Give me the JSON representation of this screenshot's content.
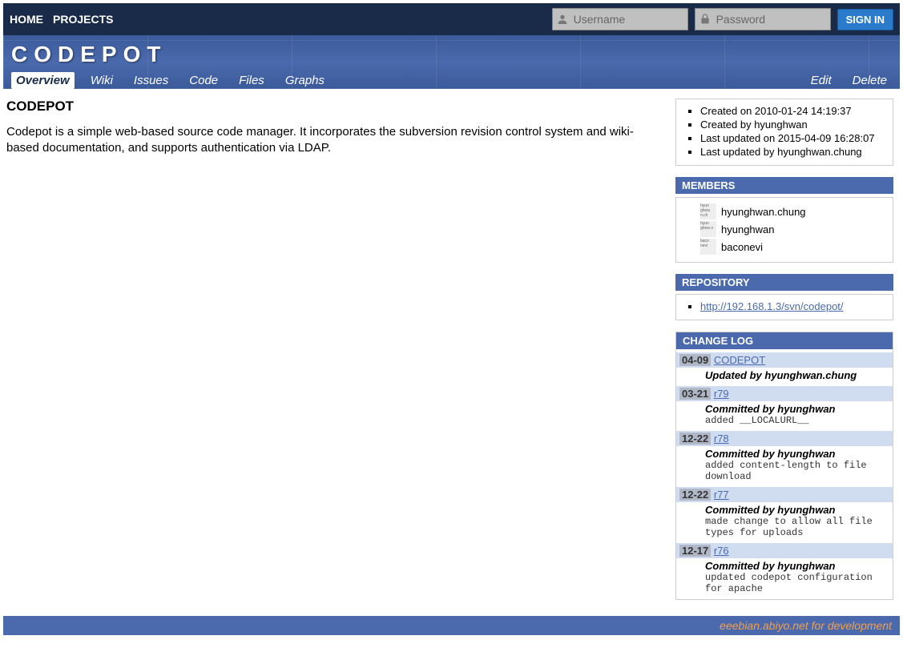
{
  "topnav": {
    "home": "HOME",
    "projects": "PROJECTS"
  },
  "login": {
    "username_ph": "Username",
    "password_ph": "Password",
    "signin": "SIGN IN"
  },
  "banner_title": "CODEPOT",
  "tabs": {
    "overview": "Overview",
    "wiki": "Wiki",
    "issues": "Issues",
    "code": "Code",
    "files": "Files",
    "graphs": "Graphs",
    "edit": "Edit",
    "delete": "Delete"
  },
  "main": {
    "title": "CODEPOT",
    "desc": "Codepot is a simple web-based source code manager. It incorporates the subversion revision control system and wiki-based documentation, and supports authentication via LDAP."
  },
  "meta": {
    "created_on": "Created on 2010-01-24 14:19:37",
    "created_by": "Created by hyunghwan",
    "updated_on": "Last updated on 2015-04-09 16:28:07",
    "updated_by": "Last updated by hyunghwan.chung"
  },
  "members_header": "MEMBERS",
  "members": [
    {
      "avatar": "hyun ghwa n.ch",
      "name": "hyunghwan.chung"
    },
    {
      "avatar": "hyun ghwa n",
      "name": "hyunghwan"
    },
    {
      "avatar": "baco nevi",
      "name": "baconevi"
    }
  ],
  "repo_header": "REPOSITORY",
  "repo_url": "http://192.168.1.3/svn/codepot/",
  "changelog_header": "CHANGE LOG",
  "changelog": [
    {
      "date": "04-09",
      "rev": "CODEPOT",
      "who": "Updated by hyunghwan.chung",
      "msg": ""
    },
    {
      "date": "03-21",
      "rev": "r79",
      "who": "Committed by hyunghwan",
      "msg": "added __LOCALURL__"
    },
    {
      "date": "12-22",
      "rev": "r78",
      "who": "Committed by hyunghwan",
      "msg": "added content-length to file download"
    },
    {
      "date": "12-22",
      "rev": "r77",
      "who": "Committed by hyunghwan",
      "msg": "made change to allow all file types for uploads"
    },
    {
      "date": "12-17",
      "rev": "r76",
      "who": "Committed by hyunghwan",
      "msg": "updated codepot configuration for apache"
    }
  ],
  "footer": "eeebian.abiyo.net for development"
}
